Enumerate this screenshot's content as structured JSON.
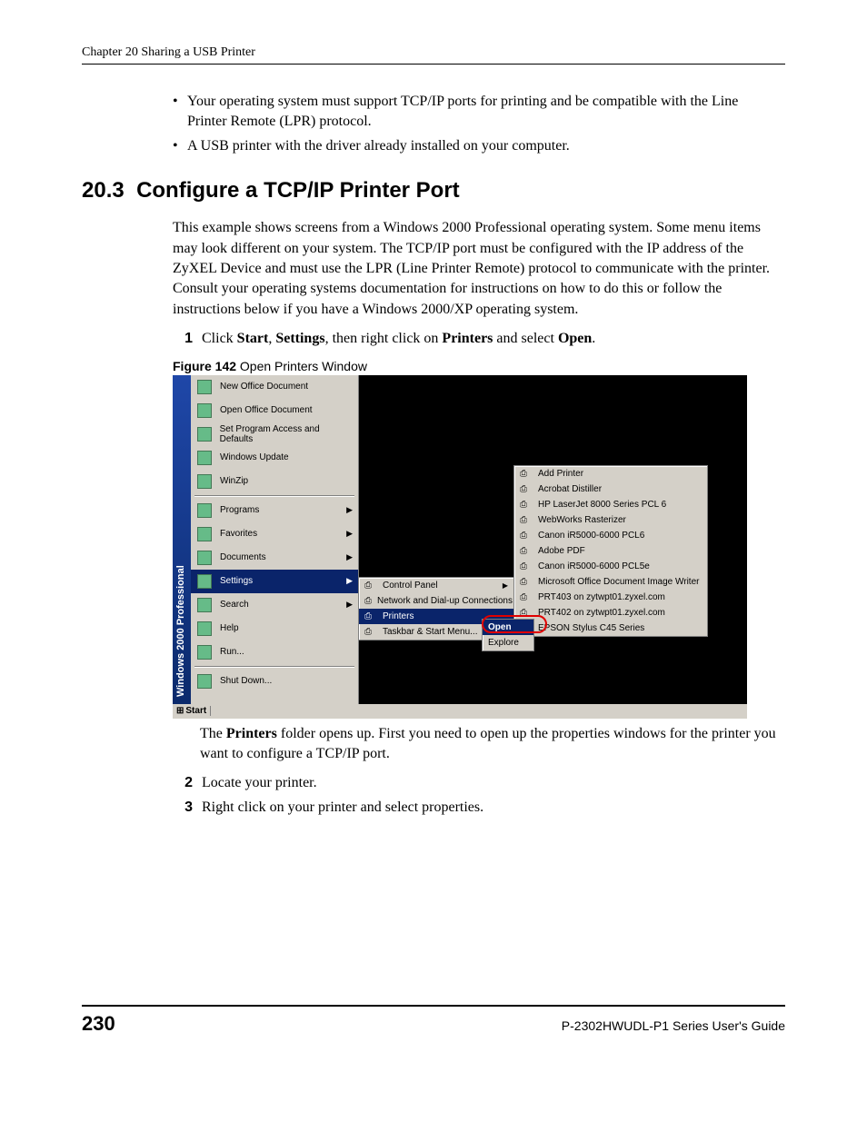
{
  "chapter_header": "Chapter 20 Sharing a USB Printer",
  "bullets": [
    "Your operating system must support TCP/IP ports for printing and be compatible with the Line Printer Remote (LPR) protocol.",
    "A USB printer with the driver already installed on your computer."
  ],
  "section_number": "20.3",
  "section_title": "Configure a TCP/IP Printer Port",
  "intro_paragraph": "This example shows screens from a Windows 2000 Professional operating system. Some menu items may look different on your system. The TCP/IP port must be configured with the IP address of the ZyXEL Device and must use the LPR (Line Printer Remote) protocol to communicate with the printer. Consult your operating systems documentation for instructions on how to do this or follow the instructions below if you have a Windows 2000/XP operating system.",
  "step1": {
    "num": "1",
    "pre": "Click ",
    "b1": "Start",
    "mid1": ", ",
    "b2": "Settings",
    "mid2": ", then right click on ",
    "b3": "Printers",
    "mid3": " and select ",
    "b4": "Open",
    "post": "."
  },
  "figure": {
    "label": "Figure 142",
    "caption": "   Open Printers Window"
  },
  "paragraph_after_figure": {
    "pre": "The ",
    "bold": "Printers",
    "post": " folder opens up. First you need to open up the properties windows for the printer you want to configure a TCP/IP port."
  },
  "step2": {
    "num": "2",
    "text": "Locate your printer."
  },
  "step3": {
    "num": "3",
    "text": "Right click on your printer and select properties."
  },
  "footer": {
    "page": "230",
    "guide": "P-2302HWUDL-P1 Series User's Guide"
  },
  "screenshot": {
    "strip_label_1": "Windows",
    "strip_label_2": "2000",
    "strip_label_3": "Professional",
    "start_menu": [
      {
        "label": "New Office Document",
        "icon": "doc-icon"
      },
      {
        "label": "Open Office Document",
        "icon": "folder-icon"
      },
      {
        "label": "Set Program Access and Defaults",
        "icon": "gear-icon"
      },
      {
        "label": "Windows Update",
        "icon": "globe-icon"
      },
      {
        "label": "WinZip",
        "icon": "zip-icon"
      }
    ],
    "start_menu2": [
      {
        "label": "Programs",
        "icon": "programs-icon",
        "arrow": true
      },
      {
        "label": "Favorites",
        "icon": "star-icon",
        "arrow": true
      },
      {
        "label": "Documents",
        "icon": "docs-icon",
        "arrow": true
      },
      {
        "label": "Settings",
        "icon": "settings-icon",
        "arrow": true,
        "hover": true
      },
      {
        "label": "Search",
        "icon": "search-icon",
        "arrow": true
      },
      {
        "label": "Help",
        "icon": "help-icon"
      },
      {
        "label": "Run...",
        "icon": "run-icon"
      }
    ],
    "start_menu3": [
      {
        "label": "Shut Down...",
        "icon": "shutdown-icon"
      }
    ],
    "settings_submenu": [
      {
        "label": "Control Panel",
        "icon": "control-panel-icon",
        "arrow": true
      },
      {
        "label": "Network and Dial-up Connections",
        "icon": "network-icon",
        "arrow": true
      },
      {
        "label": "Printers",
        "icon": "printers-icon",
        "arrow": false,
        "hover": true
      },
      {
        "label": "Taskbar & Start Menu...",
        "icon": "taskbar-icon",
        "arrow": false
      }
    ],
    "printers_submenu": [
      {
        "label": "Add Printer",
        "icon": "add-printer-icon"
      },
      {
        "label": "Acrobat Distiller",
        "icon": "printer-icon"
      },
      {
        "label": "HP LaserJet 8000 Series PCL 6",
        "icon": "printer-icon"
      },
      {
        "label": "WebWorks Rasterizer",
        "icon": "printer-icon"
      },
      {
        "label": "Canon iR5000-6000 PCL6",
        "icon": "printer-icon"
      },
      {
        "label": "Adobe PDF",
        "icon": "printer-icon"
      },
      {
        "label": "Canon iR5000-6000 PCL5e",
        "icon": "printer-icon"
      },
      {
        "label": "Microsoft Office Document Image Writer",
        "icon": "printer-icon"
      },
      {
        "label": "PRT403 on zytwpt01.zyxel.com",
        "icon": "printer-icon"
      },
      {
        "label": "PRT402 on zytwpt01.zyxel.com",
        "icon": "printer-icon"
      },
      {
        "label": "EPSON Stylus C45 Series",
        "icon": "printer-icon"
      }
    ],
    "context_menu": [
      {
        "label": "Open",
        "hover": true
      },
      {
        "label": "Explore",
        "hover": false
      }
    ],
    "start_button": "Start"
  }
}
